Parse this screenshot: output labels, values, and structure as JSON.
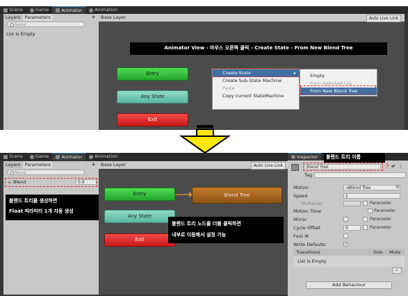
{
  "top": {
    "tabs": [
      {
        "label": "Scene",
        "icon": "grid-icon"
      },
      {
        "label": "Game",
        "icon": "gamepad-icon"
      },
      {
        "label": "Animator",
        "icon": "animator-icon"
      },
      {
        "label": "Animation",
        "icon": "animation-icon"
      }
    ],
    "left_tabs": [
      "Layers",
      "Parameters"
    ],
    "add_symbol": "+",
    "search_placeholder": "Name",
    "list_empty": "List is Empty",
    "breadcrumb": "Base Layer",
    "auto_live_link": "Auto Live Link",
    "banner": "Animator View - 마우스 오른쪽 클릭 - Create State - From New Blend Tree",
    "nodes": {
      "entry": "Entry",
      "any": "Any State",
      "exit": "Exit"
    },
    "context_menu": [
      {
        "label": "Create State",
        "has_submenu": true
      },
      {
        "label": "Create Sub-State Machine"
      },
      {
        "label": "Paste",
        "disabled": true
      },
      {
        "label": "Copy current StateMachine"
      }
    ],
    "submenu": [
      {
        "label": "Empty"
      },
      {
        "label": "From Selected Clip",
        "disabled": true
      },
      {
        "label": "From New Blend Tree"
      }
    ]
  },
  "arrow": {
    "color": "#ffe800"
  },
  "bottom": {
    "tabs": [
      {
        "label": "Scene",
        "icon": "grid-icon"
      },
      {
        "label": "Game",
        "icon": "gamepad-icon"
      },
      {
        "label": "Animator",
        "icon": "animator-icon"
      },
      {
        "label": "Animation",
        "icon": "animation-icon"
      }
    ],
    "left_tabs": [
      "Layers",
      "Parameters"
    ],
    "add_symbol": "+",
    "search_placeholder": "Name",
    "param_name": "Blend",
    "param_value": "0.0",
    "callout_left": [
      "블렌드 트리를 생성하면",
      "Float 파라미터 1개 자동 생성"
    ],
    "breadcrumb": "Base Layer",
    "auto_live_link": "Auto Live Link",
    "nodes": {
      "entry": "Entry",
      "any": "Any State",
      "exit": "Exit",
      "blend": "Blend Tree"
    },
    "callout_center": [
      "블렌드 트리 노드를 더블 클릭하면",
      "내부로 이동해서 설정 가능"
    ],
    "inspector": {
      "tab": "Inspector",
      "callout": "블렌드 트리 이름",
      "name": "Blend Tree",
      "tag_label": "Tag",
      "fields": {
        "motion_label": "Motion",
        "motion_value": "⊲Blend Tree",
        "speed_label": "Speed",
        "speed_value": "1",
        "multiplier_label": "Multiplier",
        "motion_time_label": "Motion Time",
        "mirror_label": "Mirror",
        "cycle_offset_label": "Cycle Offset",
        "cycle_offset_value": "0",
        "foot_ik_label": "Foot IK",
        "write_defaults_label": "Write Defaults",
        "parameter_label": "Parameter"
      },
      "transitions": {
        "header": "Transitions",
        "solo": "Solo",
        "mute": "Mute",
        "empty": "List is Empty",
        "remove": "−"
      },
      "add_behaviour": "Add Behaviour"
    }
  }
}
